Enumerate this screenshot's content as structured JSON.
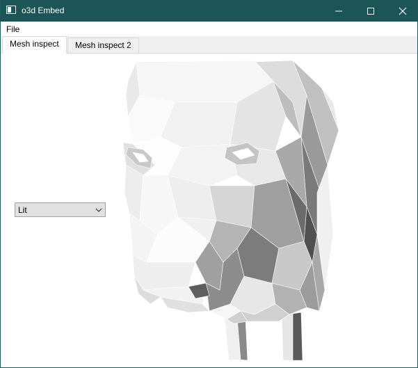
{
  "window": {
    "title": "o3d Embed"
  },
  "menu": {
    "file_label": "File"
  },
  "tabs": [
    {
      "label": "Mesh inspect"
    },
    {
      "label": "Mesh inspect 2"
    }
  ],
  "viewer": {
    "render_mode": "Lit"
  },
  "colors": {
    "titlebar": "#1b5557",
    "mesh_light": "#f2f2f2",
    "mesh_shadow": "#6a6a6a"
  }
}
